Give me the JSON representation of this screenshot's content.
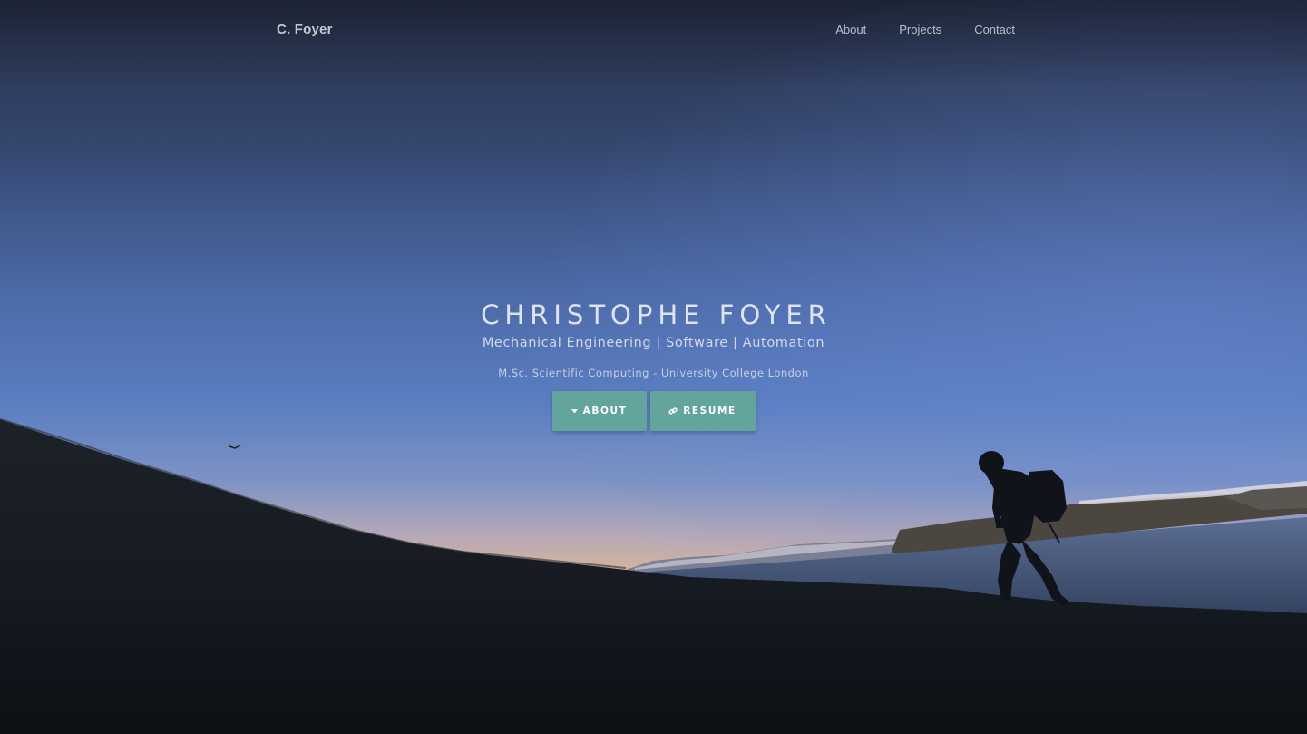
{
  "brand": "C. Foyer",
  "nav": {
    "about": "About",
    "projects": "Projects",
    "contact": "Contact"
  },
  "hero": {
    "title": "CHRISTOPHE FOYER",
    "subtitle": "Mechanical Engineering | Software | Automation",
    "degree": "M.Sc. Scientific Computing - University College London",
    "buttons": {
      "about": "ABOUT",
      "resume": "RESUME"
    }
  },
  "icons": {
    "about": "caret-down-icon",
    "resume": "link-icon"
  },
  "colors": {
    "button": "#63a59d",
    "sky_top": "#2a3550",
    "sky_mid": "#5577bb",
    "horizon": "#c9a98c",
    "ground": "#14181f"
  }
}
